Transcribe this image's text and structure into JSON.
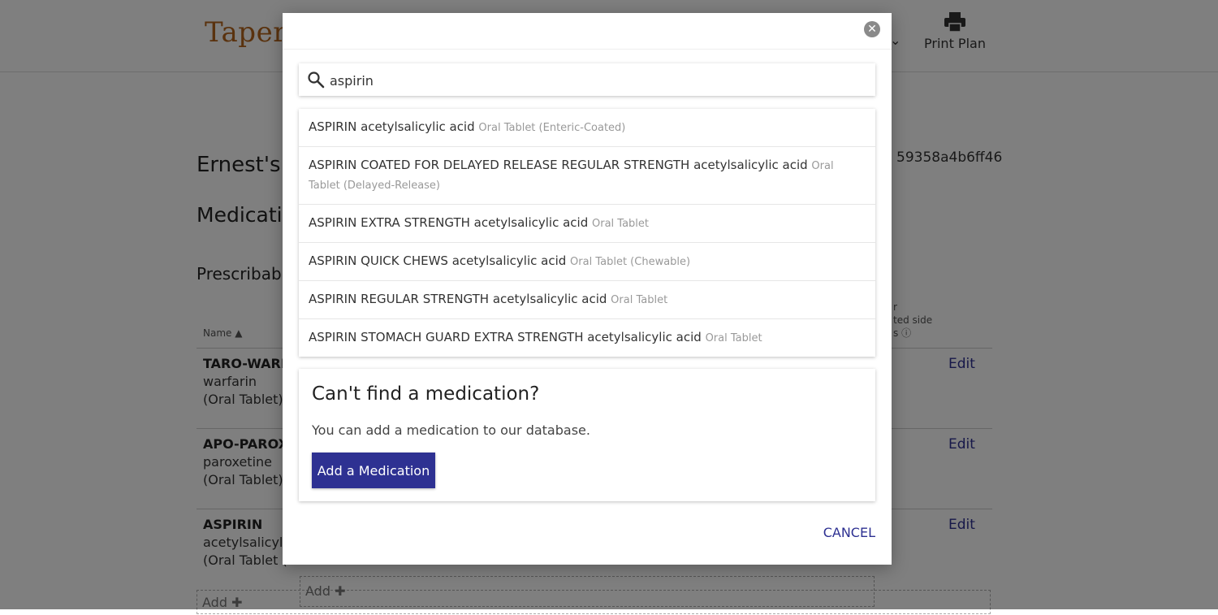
{
  "background": {
    "logo": "Taper",
    "print_plan_label": "Print Plan",
    "plan_title": "Ernest's T",
    "plan_id": "59358a4b6ff46",
    "medications_heading": "Medicatio",
    "prescribable_heading": "Prescribabl",
    "col_name": "Name ▲",
    "col_side": [
      "r",
      "ted side",
      "s ⓘ"
    ],
    "rows": [
      {
        "brand": "TARO-WARFA",
        "generic": "warfarin",
        "form": "(Oral Tablet)",
        "edit": "Edit"
      },
      {
        "brand": "APO-PAROXE",
        "generic": "paroxetine",
        "form": "(Oral Tablet)",
        "edit": "Edit"
      },
      {
        "brand": "ASPIRIN",
        "generic": "acetylsalicylic",
        "form": "(Oral Tablet (",
        "edit": "Edit"
      }
    ],
    "add_row_label": "Add ✚",
    "add_inner_label": "Add ✚"
  },
  "modal": {
    "close_icon": "✕",
    "search": {
      "value": "aspirin",
      "placeholder": "Search medications",
      "icon": "search-icon"
    },
    "results": [
      {
        "name": "ASPIRIN acetylsalicylic acid",
        "form": "Oral Tablet (Enteric-Coated)"
      },
      {
        "name": "ASPIRIN COATED FOR DELAYED RELEASE REGULAR STRENGTH acetylsalicylic acid",
        "form": "Oral Tablet (Delayed-Release)"
      },
      {
        "name": "ASPIRIN EXTRA STRENGTH acetylsalicylic acid",
        "form": "Oral Tablet"
      },
      {
        "name": "ASPIRIN QUICK CHEWS acetylsalicylic acid",
        "form": "Oral Tablet (Chewable)"
      },
      {
        "name": "ASPIRIN REGULAR STRENGTH acetylsalicylic acid",
        "form": "Oral Tablet"
      },
      {
        "name": "ASPIRIN STOMACH GUARD EXTRA STRENGTH acetylsalicylic acid",
        "form": "Oral Tablet"
      }
    ],
    "cant_find": {
      "heading": "Can't find a medication?",
      "text": "You can add a medication to our database.",
      "button": "Add a Medication"
    },
    "cancel_label": "CANCEL"
  },
  "colors": {
    "accent": "#2e3192",
    "overlay": "rgba(0,0,0,0.5)",
    "muted_text": "#999999"
  }
}
